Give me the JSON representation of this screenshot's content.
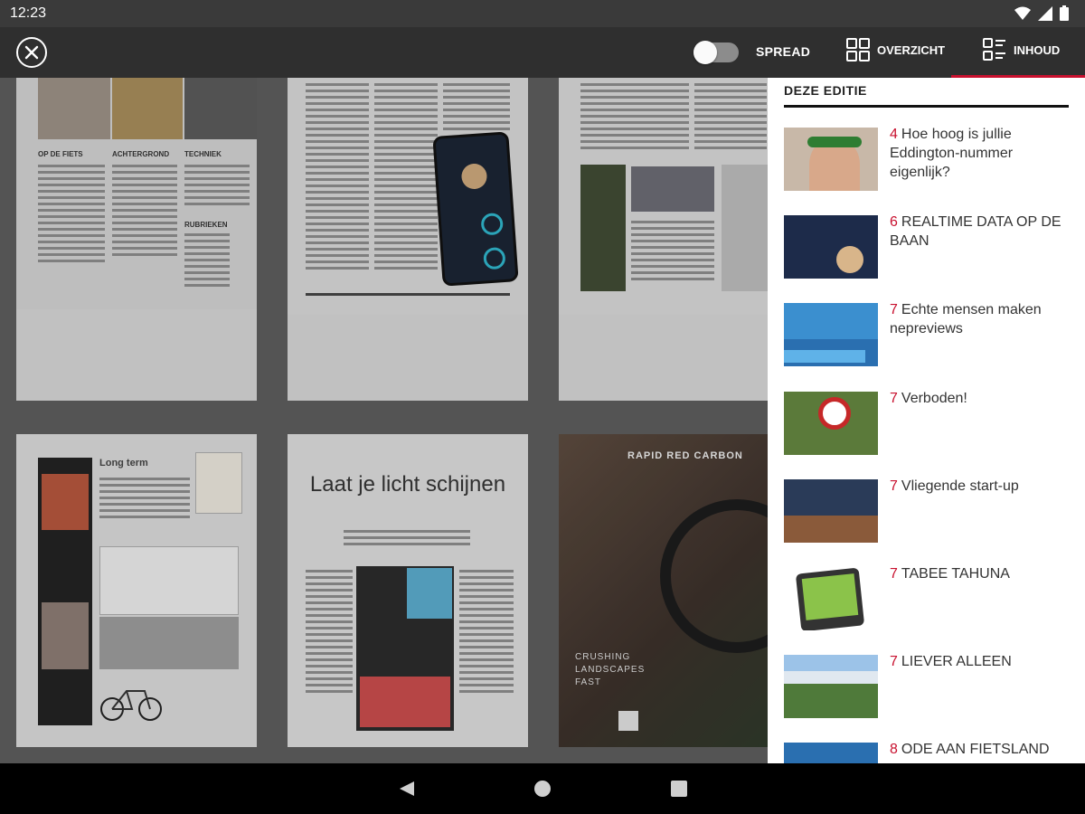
{
  "status": {
    "time": "12:23"
  },
  "toolbar": {
    "spread_label": "SPREAD",
    "overview_label": "OVERZICHT",
    "content_label": "INHOUD",
    "spread_on": false,
    "accent": "#c8102e"
  },
  "pages": {
    "page1_headings": [
      "OP DE FIETS",
      "ACHTERGROND",
      "TECHNIEK",
      "RUBRIEKEN"
    ],
    "page5_title": "Long term",
    "page6_title": "Laat je licht schijnen",
    "page7_brand": "RAPID RED CARBON",
    "page7_slogan": "CRUSHING LANDSCAPES FAST"
  },
  "sidebar": {
    "title": "DEZE EDITIE",
    "items": [
      {
        "page": "4",
        "title": "Hoe hoog is jullie Eddington-nummer eigenlijk?"
      },
      {
        "page": "6",
        "title": "REALTIME DATA OP DE BAAN"
      },
      {
        "page": "7",
        "title": "Echte mensen maken nepreviews"
      },
      {
        "page": "7",
        "title": "Verboden!"
      },
      {
        "page": "7",
        "title": "Vliegende start-up"
      },
      {
        "page": "7",
        "title": "TABEE TAHUNA"
      },
      {
        "page": "7",
        "title": "LIEVER ALLEEN"
      },
      {
        "page": "8",
        "title": "ODE AAN FIETSLAND"
      }
    ]
  }
}
